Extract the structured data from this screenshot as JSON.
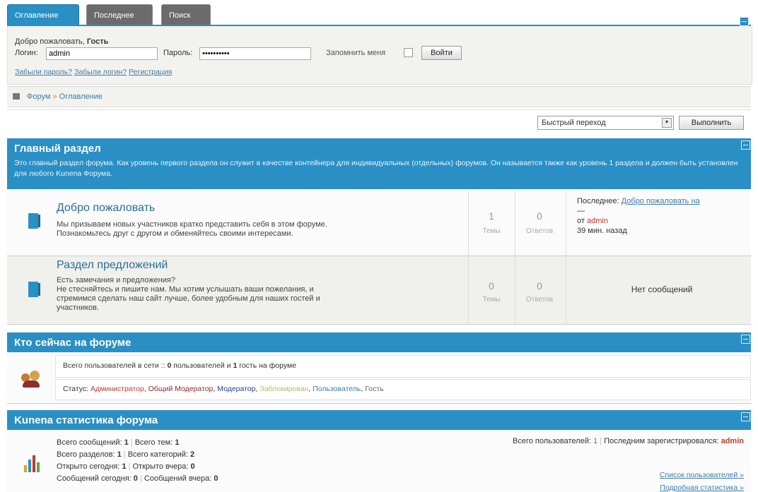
{
  "tabs": [
    {
      "label": "Оглавление",
      "active": true
    },
    {
      "label": "Последнее",
      "active": false
    },
    {
      "label": "Поиск",
      "active": false
    }
  ],
  "login": {
    "welcome": "Добро пожаловать,",
    "guest": "Гость",
    "login_label": "Логин:",
    "login_value": "admin",
    "password_label": "Пароль:",
    "password_value": "••••••••••",
    "remember_label": "Запомнить меня",
    "submit": "Войти",
    "forgot_password": "Забыли пароль?",
    "forgot_login": "Забыли логин?",
    "register": "Регистрация"
  },
  "breadcrumb": {
    "root": "Форум",
    "separator": "»",
    "current": "Оглавление"
  },
  "quick_jump": {
    "select_value": "Быстрый переход",
    "button": "Выполнить"
  },
  "main_section": {
    "title": "Главный раздел",
    "description": "Это главный раздел форума. Как уровень первого раздела он служит в качестве контейнера для индивидуальных (отдельных) форумов. Он называется также как уровень 1 раздела и должен быть установлен для любого Kunena Форума.",
    "forums": [
      {
        "title": "Добро пожаловать",
        "desc_line1": "Мы призываем новых участников кратко представить себя в этом форуме.",
        "desc_line2": "Познакомьтесь друг с другом и обменяйтесь своими интересами.",
        "topics": "1",
        "topics_label": "Темы",
        "replies": "0",
        "replies_label": "Ответов",
        "last_prefix": "Последнее:",
        "last_link": "Добро пожаловать на",
        "last_dash": "—",
        "last_by": "от",
        "last_user": "admin",
        "last_time": "39 мин. назад"
      },
      {
        "title": "Раздел предложений",
        "desc_line1": "Есть замечания и предложения?",
        "desc_line2": "Не стесняйтесь и пишите нам. Мы хотим услышать ваши пожелания, и",
        "desc_line3": "стремимся сделать наш сайт лучше, более удобным для наших гостей и",
        "desc_line4": "участников.",
        "topics": "0",
        "topics_label": "Темы",
        "replies": "0",
        "replies_label": "Ответов",
        "no_posts": "Нет сообщений"
      }
    ]
  },
  "whos_online": {
    "title": "Кто сейчас на форуме",
    "total_prefix": "Всего пользователей в сети ::",
    "users_count": "0",
    "users_text": "пользователей и",
    "guests_count": "1",
    "guests_text": "гость на форуме",
    "status_label": "Статус:",
    "roles": [
      {
        "label": "Администратор",
        "color": "#c0392b"
      },
      {
        "label": "Общий Модератор",
        "color": "#8b2e2e"
      },
      {
        "label": "Модератор",
        "color": "#2c3e8c"
      },
      {
        "label": "Заблокирован",
        "color": "#b5b86a"
      },
      {
        "label": "Пользователь",
        "color": "#3a7ea8"
      },
      {
        "label": "Гость",
        "color": "#666666"
      }
    ]
  },
  "stats": {
    "title": "Kunena статистика форума",
    "total_messages_label": "Всего сообщений:",
    "total_messages": "1",
    "total_topics_label": "Всего тем:",
    "total_topics": "1",
    "total_sections_label": "Всего разделов:",
    "total_sections": "1",
    "total_categories_label": "Всего категорий:",
    "total_categories": "2",
    "opened_today_label": "Открыто сегодня:",
    "opened_today": "1",
    "opened_yesterday_label": "Открыто вчера:",
    "opened_yesterday": "0",
    "msgs_today_label": "Сообщений сегодня:",
    "msgs_today": "0",
    "msgs_yesterday_label": "Сообщений вчера:",
    "msgs_yesterday": "0",
    "total_users_label": "Всего пользователей:",
    "total_users": "1",
    "last_registered_label": "Последним зарегистрировался:",
    "last_registered": "admin",
    "user_list_link": "Список пользователей »",
    "detailed_stats_link": "Подробная статистика »"
  },
  "colors": {
    "accent": "#2a8fc4",
    "tab_inactive": "#6b6b6b",
    "panel": "#f2f2ee"
  }
}
